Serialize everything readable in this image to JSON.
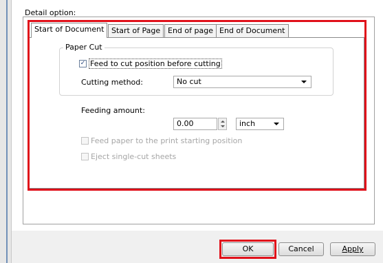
{
  "dialog": {
    "detail_option_label": "Detail option:",
    "tabs": [
      {
        "label": "Start of Document",
        "active": true
      },
      {
        "label": "Start of Page",
        "active": false
      },
      {
        "label": "End of page",
        "active": false
      },
      {
        "label": "End of Document",
        "active": false
      }
    ],
    "paper_cut": {
      "group_label": "Paper Cut",
      "feed_to_cut_label": "Feed to cut position before cutting",
      "feed_to_cut_checked": true,
      "cutting_method_label": "Cutting method:",
      "cutting_method_value": "No cut"
    },
    "feeding": {
      "label": "Feeding amount:",
      "value": "0.00",
      "unit": "inch"
    },
    "feed_paper_to_print_start_label": "Feed paper to the print starting position",
    "eject_single_cut_label": "Eject single-cut sheets",
    "buttons": {
      "ok": "OK",
      "cancel": "Cancel",
      "apply": "Apply"
    }
  },
  "colors": {
    "highlight_frame": "#e0101a",
    "tab_border": "#8a8a8a",
    "background": "#f0f0f0"
  }
}
